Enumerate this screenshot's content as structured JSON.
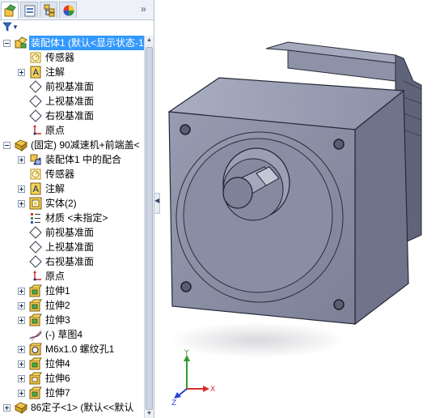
{
  "tabs": [
    {
      "name": "featuremanager-tab",
      "icon": "feature-tree-icon"
    },
    {
      "name": "propertymanager-tab",
      "icon": "property-manager-icon"
    },
    {
      "name": "configurationmanager-tab",
      "icon": "configuration-icon"
    },
    {
      "name": "appearance-tab",
      "icon": "appearance-icon"
    }
  ],
  "tab_overflow": "»",
  "filter": {
    "icon": "filter-icon"
  },
  "tree": [
    {
      "label": "装配体1  (默认<显示状态-1>",
      "icon": "assembly-icon",
      "indent": 0,
      "expander": "minus",
      "selected": true
    },
    {
      "label": "传感器",
      "icon": "sensor-icon",
      "indent": 1,
      "expander": "none"
    },
    {
      "label": "注解",
      "icon": "annotation-icon",
      "indent": 1,
      "expander": "plus"
    },
    {
      "label": "前视基准面",
      "icon": "plane-icon",
      "indent": 1,
      "expander": "none"
    },
    {
      "label": "上视基准面",
      "icon": "plane-icon",
      "indent": 1,
      "expander": "none"
    },
    {
      "label": "右视基准面",
      "icon": "plane-icon",
      "indent": 1,
      "expander": "none"
    },
    {
      "label": "原点",
      "icon": "origin-icon",
      "indent": 1,
      "expander": "none"
    },
    {
      "label": "(固定) 90减速机+前端盖<",
      "icon": "part-icon",
      "indent": 0,
      "expander": "minus"
    },
    {
      "label": "装配体1 中的配合",
      "icon": "mates-icon",
      "indent": 2,
      "expander": "plus"
    },
    {
      "label": "传感器",
      "icon": "sensor-icon",
      "indent": 2,
      "expander": "none"
    },
    {
      "label": "注解",
      "icon": "annotation-icon",
      "indent": 2,
      "expander": "plus"
    },
    {
      "label": "实体(2)",
      "icon": "solid-body-icon",
      "indent": 2,
      "expander": "plus"
    },
    {
      "label": "材质 <未指定>",
      "icon": "material-icon",
      "indent": 2,
      "expander": "none"
    },
    {
      "label": "前视基准面",
      "icon": "plane-icon",
      "indent": 2,
      "expander": "none"
    },
    {
      "label": "上视基准面",
      "icon": "plane-icon",
      "indent": 2,
      "expander": "none"
    },
    {
      "label": "右视基准面",
      "icon": "plane-icon",
      "indent": 2,
      "expander": "none"
    },
    {
      "label": "原点",
      "icon": "origin-icon",
      "indent": 2,
      "expander": "none"
    },
    {
      "label": "拉伸1",
      "icon": "extrude-icon",
      "indent": 2,
      "expander": "plus"
    },
    {
      "label": "拉伸2",
      "icon": "extrude-icon",
      "indent": 2,
      "expander": "plus"
    },
    {
      "label": "拉伸3",
      "icon": "extrude-icon",
      "indent": 2,
      "expander": "plus"
    },
    {
      "label": "(-) 草图4",
      "icon": "sketch-icon",
      "indent": 2,
      "expander": "none"
    },
    {
      "label": "M6x1.0 螺纹孔1",
      "icon": "hole-wizard-icon",
      "indent": 2,
      "expander": "plus"
    },
    {
      "label": "拉伸4",
      "icon": "extrude-icon",
      "indent": 2,
      "expander": "plus"
    },
    {
      "label": "拉伸6",
      "icon": "extrude-cut-icon",
      "indent": 2,
      "expander": "plus"
    },
    {
      "label": "拉伸7",
      "icon": "extrude-icon",
      "indent": 2,
      "expander": "plus"
    },
    {
      "label": "86定子<1> (默认<<默认",
      "icon": "part-icon",
      "indent": 0,
      "expander": "plus"
    }
  ],
  "viewport": {
    "model": "gearbox-motor-assembly",
    "triad_labels": {
      "x": "X",
      "y": "Y",
      "z": "Z"
    },
    "colors": {
      "part_face_front": "#8b90a6",
      "part_face_side": "#6e7389",
      "part_face_top": "#9ea3b8",
      "triad_x": "#d6302a",
      "triad_y": "#2d9b2d",
      "triad_z": "#2b3fd0"
    }
  },
  "collapse_handle": "◀"
}
